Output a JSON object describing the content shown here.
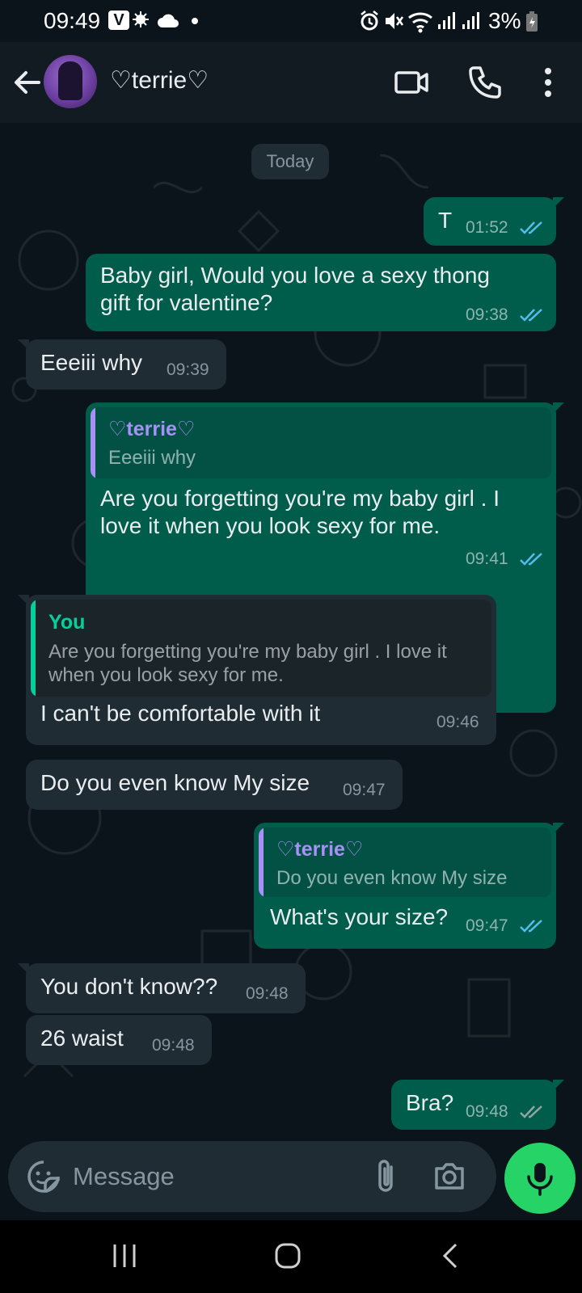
{
  "status_bar": {
    "time": "09:49",
    "carrier_badge": "V",
    "battery": "3%",
    "icons": [
      "alarm-icon",
      "mute-icon",
      "wifi-icon",
      "signal-icon",
      "signal-icon",
      "battery-icon",
      "weather-icon",
      "cloud-icon"
    ]
  },
  "header": {
    "contact_name": "♡terrie♡",
    "icons": [
      "back-arrow-icon",
      "video-call-icon",
      "voice-call-icon",
      "more-options-icon"
    ]
  },
  "chat": {
    "date_chip": "Today",
    "messages": [
      {
        "dir": "out",
        "text": "T",
        "time": "01:52",
        "status": "read"
      },
      {
        "dir": "out",
        "text": "Baby girl, Would you love a sexy thong gift for valentine?",
        "time": "09:38",
        "status": "read"
      },
      {
        "dir": "in",
        "text": "Eeeiii why",
        "time": "09:39"
      },
      {
        "dir": "out",
        "reply_to": {
          "name": "♡terrie♡",
          "text": "Eeeiii why"
        },
        "text": "Are you forgetting you're my  baby girl . I love it when you look sexy for me.",
        "time": "09:41",
        "status": "read"
      },
      {
        "dir": "in",
        "reply_to": {
          "name": "You",
          "text": "Are you forgetting you're my  baby girl . I love it when you look sexy for me."
        },
        "text": "I can't be comfortable with it",
        "time": "09:46"
      },
      {
        "dir": "in",
        "text": "Do you even know My size",
        "time": "09:47"
      },
      {
        "dir": "out",
        "reply_to": {
          "name": "♡terrie♡",
          "text": "Do you even know My size"
        },
        "text": "What's your size?",
        "time": "09:47",
        "status": "read"
      },
      {
        "dir": "in",
        "text": "You don't know??",
        "time": "09:48"
      },
      {
        "dir": "in",
        "text": "26 waist",
        "time": "09:48"
      },
      {
        "dir": "out",
        "text": "Bra?",
        "time": "09:48",
        "status": "delivered"
      }
    ]
  },
  "composer": {
    "placeholder": "Message",
    "icons": [
      "emoji-sticker-icon",
      "attach-icon",
      "camera-icon",
      "mic-icon"
    ]
  },
  "nav_bar": {
    "icons": [
      "recents-icon",
      "home-icon",
      "back-icon"
    ]
  },
  "colors": {
    "outgoing_bubble": "#005c4b",
    "incoming_bubble": "#202c33",
    "read_tick": "#53bdeb",
    "reply_accent_you": "#06cf9c",
    "reply_accent_contact": "#a791f7",
    "mic_button": "#25d366",
    "background": "#0b141a"
  }
}
